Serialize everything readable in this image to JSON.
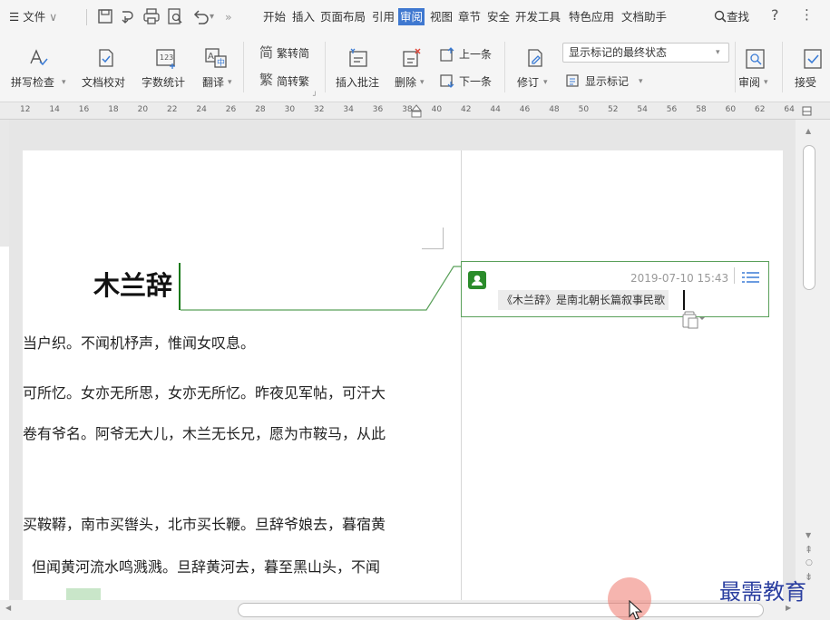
{
  "menubar": {
    "menu_label": "文件",
    "tabs": [
      "开始",
      "插入",
      "页面布局",
      "引用",
      "审阅",
      "视图",
      "章节",
      "安全",
      "开发工具",
      "特色应用",
      "文档助手"
    ],
    "active_tab": "审阅",
    "search_label": "查找",
    "help_glyph": "?",
    "more_glyph": "⋮"
  },
  "ribbon": {
    "spell_check": "拼写检查",
    "doc_proof": "文档校对",
    "word_count": "字数统计",
    "translate": "翻译",
    "to_simplified": "繁转简",
    "to_traditional": "简转繁",
    "insert_comment": "插入批注",
    "delete": "删除",
    "previous": "上一条",
    "next": "下一条",
    "revise": "修订",
    "display_state": "显示标记的最终状态",
    "show_markup": "显示标记",
    "review": "审阅",
    "accept": "接受"
  },
  "ruler": {
    "ticks": [
      "12",
      "14",
      "16",
      "18",
      "20",
      "22",
      "24",
      "26",
      "28",
      "30",
      "32",
      "34",
      "36",
      "38",
      "40",
      "42",
      "44",
      "46",
      "48",
      "50",
      "52",
      "54",
      "56",
      "58",
      "60",
      "62",
      "64"
    ]
  },
  "document": {
    "title": "木兰辞",
    "lines": [
      "当户织。不闻机杼声，惟闻女叹息。",
      "可所忆。女亦无所思，女亦无所忆。昨夜见军帖，可汗大",
      "卷有爷名。阿爷无大儿，木兰无长兄，愿为市鞍马，从此",
      "买鞍鞯，南市买辔头，北市买长鞭。旦辞爷娘去，暮宿黄",
      "但闻黄河流水鸣溅溅。旦辞黄河去，暮至黑山头，不闻"
    ]
  },
  "comment": {
    "date": "2019-07-10 15:43",
    "text": "《木兰辞》是南北朝长篇叙事民歌"
  },
  "watermark": "最需教育",
  "colors": {
    "active_tab": "#3f78d0",
    "comment_border": "#5aa05a",
    "avatar": "#2b8c2b",
    "watermark": "#2b3fa0"
  }
}
